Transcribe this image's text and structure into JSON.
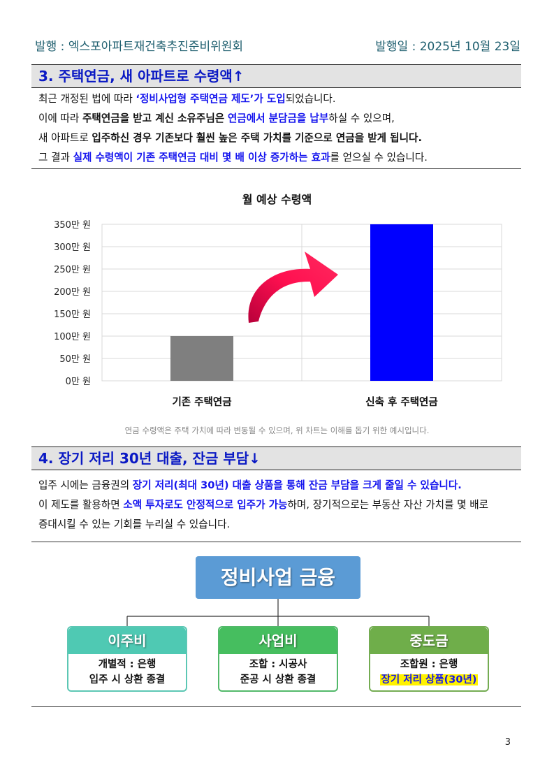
{
  "header": {
    "publisher": "발행 : 엑스포아파트재건축추진준비위원회",
    "date": "발행일 : 2025년 10월 23일"
  },
  "section3": {
    "title": "3. 주택연금, 새 아파트로 수령액↑",
    "lines": [
      [
        {
          "t": "최근 개정된 법에 따라 "
        },
        {
          "t": "‘정비사업형 주택연금 제도’가 도입",
          "s": "blue"
        },
        {
          "t": "되었습니다."
        }
      ],
      [
        {
          "t": "이에 따라 "
        },
        {
          "t": "주택연금을 받고 계신 소유주님은",
          "s": "bold"
        },
        {
          "t": " "
        },
        {
          "t": "연금에서 분담금을 납부",
          "s": "blue"
        },
        {
          "t": "하실 수 있으며,"
        }
      ],
      [
        {
          "t": "새 아파트로 "
        },
        {
          "t": "입주하신 경우 기존보다 훨씬 높은 주택 가치를 기준으로 연금을 받게 됩니다.",
          "s": "bold"
        }
      ],
      [
        {
          "t": "그 결과 "
        },
        {
          "t": "실제 수령액이 기존 주택연금 대비 몇 배 이상 증가하는 효과",
          "s": "blue"
        },
        {
          "t": "를 얻으실 수 있습니다."
        }
      ]
    ]
  },
  "chart_data": {
    "type": "bar",
    "title": "월 예상 수령액",
    "categories": [
      "기존 주택연금",
      "신축 후 주택연금"
    ],
    "values": [
      100,
      350
    ],
    "colors": [
      "#7f7f7f",
      "#0000ff"
    ],
    "ylim": [
      0,
      350
    ],
    "yticks": [
      0,
      50,
      100,
      150,
      200,
      250,
      300,
      350
    ],
    "ytick_labels": [
      "0만 원",
      "50만 원",
      "100만 원",
      "150만 원",
      "200만 원",
      "250만 원",
      "300만 원",
      "350만 원"
    ],
    "grid": true,
    "annotation": "red curved arrow pointing from first bar to second bar"
  },
  "chart_note": "연금 수령액은 주택 가치에 따라 변동될 수 있으며, 위 차트는 이해를 돕기 위한 예시입니다.",
  "section4": {
    "title": "4. 장기 저리 30년 대출, 잔금 부담↓",
    "lines": [
      [
        {
          "t": "입주 시에는 금융권의 "
        },
        {
          "t": "장기 저리(최대 30년) 대출 상품을 통해 잔금 부담을 크게 줄일 수 있습니다.",
          "s": "blue"
        }
      ],
      [
        {
          "t": "이 제도를 활용하면 "
        },
        {
          "t": "소액 투자로도 안정적으로 입주가 가능",
          "s": "blue"
        },
        {
          "t": "하며, 장기적으로는 부동산 자산 가치를 몇 배로"
        }
      ],
      [
        {
          "t": "증대시킬 수 있는 기회를 누리실 수 있습니다."
        }
      ]
    ]
  },
  "diagram": {
    "root": "정비사업 금융",
    "nodes": [
      {
        "title": "이주비",
        "color": "#4fc9b3",
        "border": "#5cc7b4",
        "lines": [
          "개별적 : 은행",
          "입주 시 상환 종결"
        ],
        "highlight": false
      },
      {
        "title": "사업비",
        "color": "#46be5f",
        "border": "#52b96a",
        "lines": [
          "조합 : 시공사",
          "준공 시 상환 종결"
        ],
        "highlight": false
      },
      {
        "title": "중도금",
        "color": "#6fae4a",
        "border": "#74ac52",
        "lines": [
          "조합원 : 은행",
          "장기 저리 상품(30년)"
        ],
        "highlight": true
      }
    ]
  },
  "page_number": "3"
}
